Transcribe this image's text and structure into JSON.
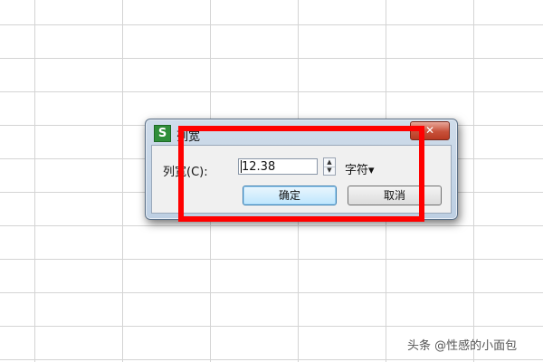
{
  "dialog": {
    "title": "列宽",
    "app_icon_glyph": "S",
    "close_glyph": "✕",
    "field_label": "列宽(C):",
    "value": "12.38",
    "unit_label": "字符▾",
    "ok_label": "确定",
    "cancel_label": "取消"
  },
  "watermark": "头条 @性感的小面包",
  "colors": {
    "highlight": "#ff0000",
    "close_button": "#c7513a",
    "app_icon": "#2f8e3a"
  }
}
